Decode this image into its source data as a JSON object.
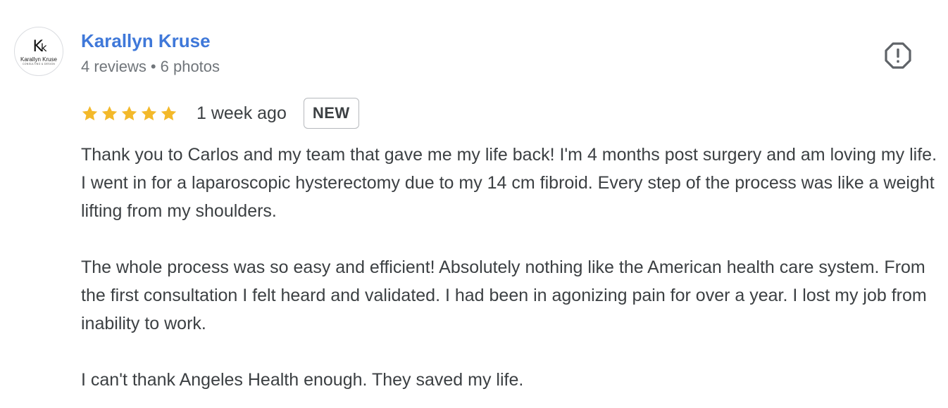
{
  "reviewer": {
    "name": "Karallyn Kruse",
    "reviews": "4 reviews",
    "separator": "•",
    "photos": "6 photos",
    "avatar": {
      "monogram_big": "K",
      "monogram_small": "k",
      "name": "Karallyn Kruse",
      "subtitle": "CONSULTING & DESIGN"
    }
  },
  "review": {
    "rating": 5,
    "max_rating": 5,
    "time": "1 week ago",
    "badge": "NEW",
    "paragraphs": [
      "Thank you to Carlos and my team that gave me my life back! I'm 4 months post surgery and am loving my life. I went in for a laparoscopic hysterectomy due to my 14 cm fibroid. Every step of the process was like a weight lifting from my shoulders.",
      "The whole process was so easy and efficient! Absolutely nothing like the American health care system. From the first consultation I felt heard and validated. I had been in agonizing pain for over a year. I lost my job from inability to work.",
      "I can't thank Angeles Health enough. They saved my life."
    ]
  },
  "icons": {
    "report": "report-flag-icon",
    "star": "star-icon"
  },
  "colors": {
    "name_link": "#3f78d9",
    "star": "#f3b92a",
    "text": "#3c4043",
    "meta": "#70757a"
  }
}
